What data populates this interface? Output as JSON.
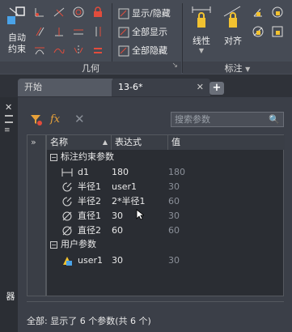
{
  "ribbon": {
    "auto_constrain_label": "自动\n约束",
    "auto_constrain_line1": "自动",
    "auto_constrain_line2": "约束",
    "show_hide": "显示/隐藏",
    "show_all": "全部显示",
    "hide_all": "全部隐藏",
    "geometry_group": "几何",
    "linear_label": "线性",
    "aligned_label": "对齐",
    "annotation_group": "标注"
  },
  "tabs": [
    {
      "label": "开始"
    },
    {
      "label": "13-6*"
    }
  ],
  "sidebar": {
    "title": "参数管理器"
  },
  "palette": {
    "search_placeholder": "搜索参数",
    "columns": [
      "名称",
      "表达式",
      "值"
    ],
    "groups": [
      {
        "title": "标注约束参数",
        "rows": [
          {
            "icon": "linear-dim-icon",
            "name": "d1",
            "expr": "180",
            "value": "180"
          },
          {
            "icon": "radius-icon",
            "name": "半径1",
            "expr": "user1",
            "value": "30"
          },
          {
            "icon": "radius-icon",
            "name": "半径2",
            "expr": "2*半径1",
            "value": "60"
          },
          {
            "icon": "diameter-icon",
            "name": "直径1",
            "expr": "30",
            "value": "30"
          },
          {
            "icon": "diameter-icon",
            "name": "直径2",
            "expr": "60",
            "value": "60"
          }
        ]
      },
      {
        "title": "用户参数",
        "rows": [
          {
            "icon": "user-param-icon",
            "name": "user1",
            "expr": "30",
            "value": "30"
          }
        ]
      }
    ],
    "status": "全部: 显示了 6 个参数(共 6 个)"
  }
}
